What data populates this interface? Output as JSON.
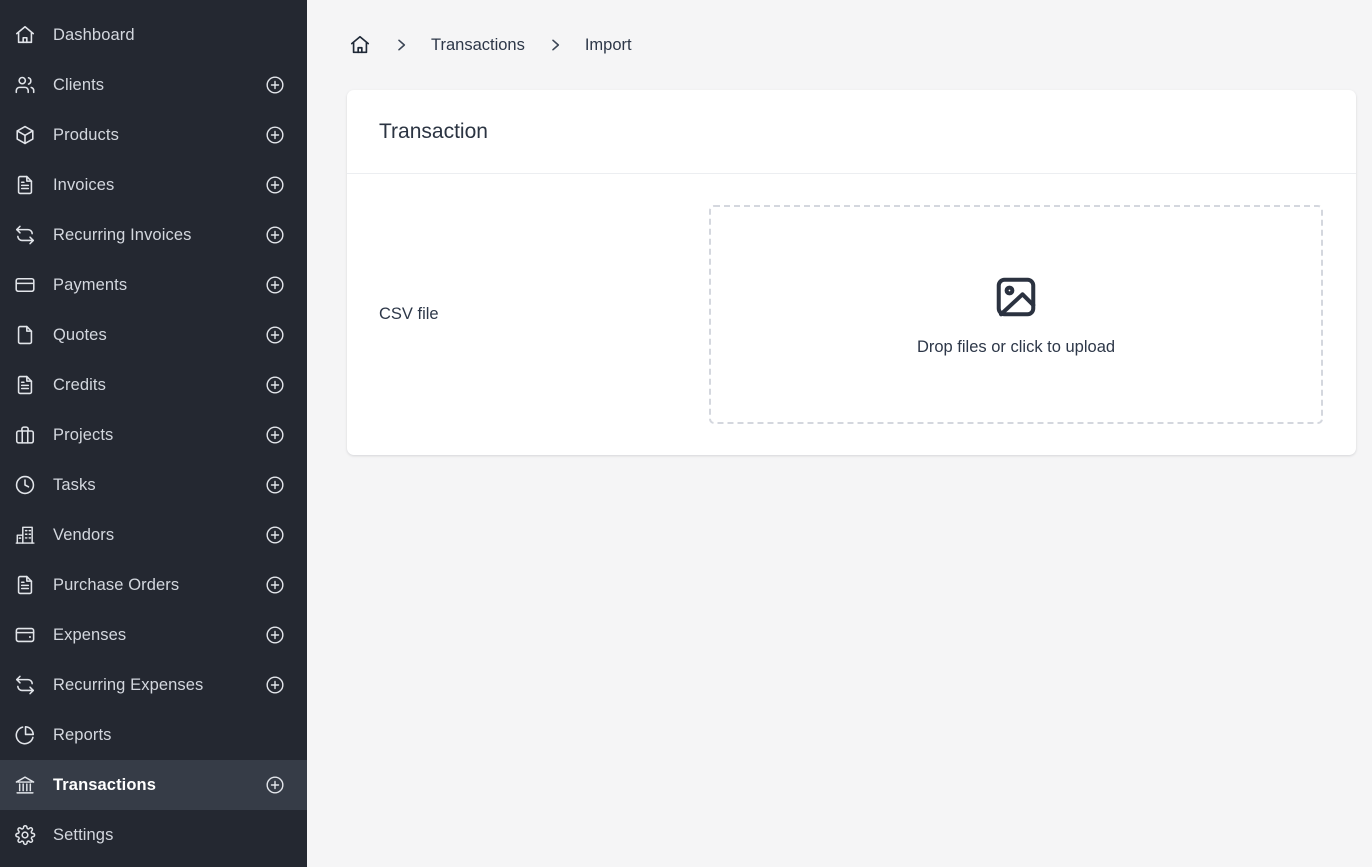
{
  "sidebar": {
    "items": [
      {
        "label": "Dashboard",
        "icon": "home-icon",
        "add": false,
        "active": false
      },
      {
        "label": "Clients",
        "icon": "users-icon",
        "add": true,
        "active": false
      },
      {
        "label": "Products",
        "icon": "box-icon",
        "add": true,
        "active": false
      },
      {
        "label": "Invoices",
        "icon": "file-text-icon",
        "add": true,
        "active": false
      },
      {
        "label": "Recurring Invoices",
        "icon": "refresh-icon",
        "add": true,
        "active": false
      },
      {
        "label": "Payments",
        "icon": "credit-card-icon",
        "add": true,
        "active": false
      },
      {
        "label": "Quotes",
        "icon": "file-icon",
        "add": true,
        "active": false
      },
      {
        "label": "Credits",
        "icon": "file-text-icon",
        "add": true,
        "active": false
      },
      {
        "label": "Projects",
        "icon": "briefcase-icon",
        "add": true,
        "active": false
      },
      {
        "label": "Tasks",
        "icon": "clock-icon",
        "add": true,
        "active": false
      },
      {
        "label": "Vendors",
        "icon": "building-icon",
        "add": true,
        "active": false
      },
      {
        "label": "Purchase Orders",
        "icon": "file-text-icon",
        "add": true,
        "active": false
      },
      {
        "label": "Expenses",
        "icon": "wallet-icon",
        "add": true,
        "active": false
      },
      {
        "label": "Recurring Expenses",
        "icon": "refresh-icon",
        "add": true,
        "active": false
      },
      {
        "label": "Reports",
        "icon": "pie-chart-icon",
        "add": false,
        "active": false
      },
      {
        "label": "Transactions",
        "icon": "bank-icon",
        "add": true,
        "active": true
      },
      {
        "label": "Settings",
        "icon": "gear-icon",
        "add": false,
        "active": false
      }
    ],
    "add_icon": "plus-circle-icon",
    "colors": {
      "background": "#242831",
      "active_background": "#363c47",
      "label": "#d3d7de",
      "active_label": "#ffffff"
    }
  },
  "breadcrumb": {
    "home_icon": "home-icon",
    "separator_icon": "chevron-right-icon",
    "items": [
      {
        "label": "Transactions",
        "current": false
      },
      {
        "label": "Import",
        "current": true
      }
    ]
  },
  "card": {
    "title": "Transaction",
    "field_label": "CSV file",
    "dropzone": {
      "icon": "image-icon",
      "text": "Drop files or click to upload"
    }
  },
  "theme": {
    "page_background": "#f5f5f6",
    "card_background": "#ffffff",
    "text": "#2d3748",
    "dropzone_border": "#d4d7de"
  }
}
